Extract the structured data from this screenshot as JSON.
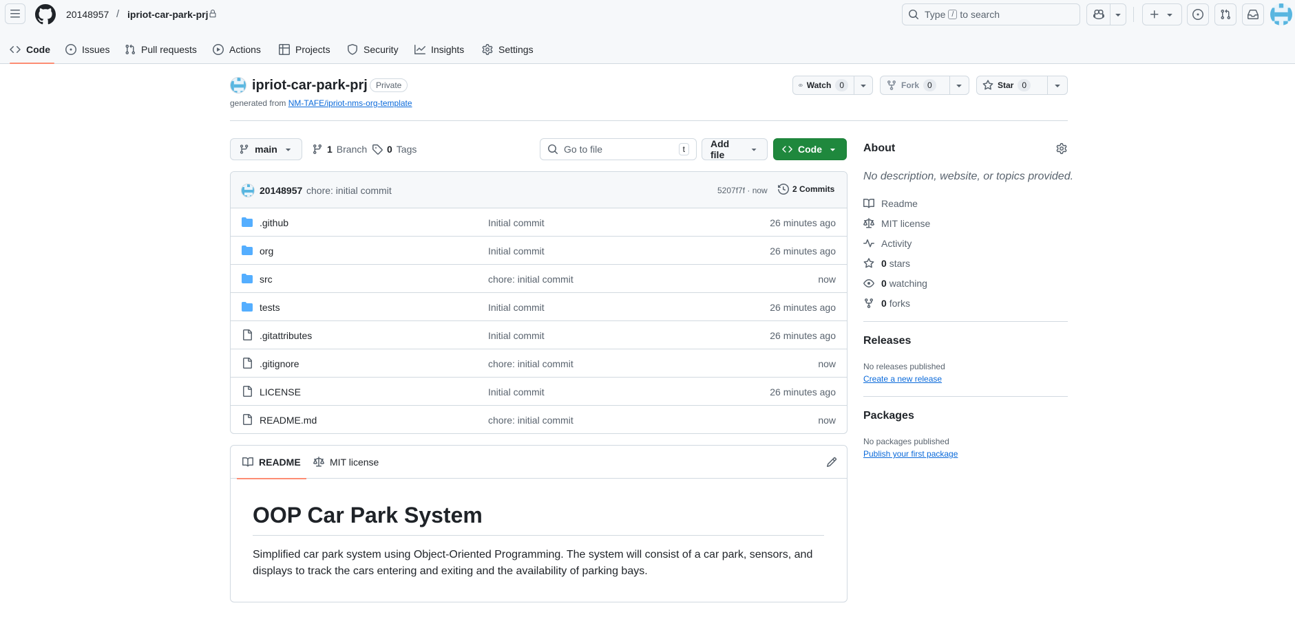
{
  "header": {
    "owner": "20148957",
    "separator": "/",
    "repo": "ipriot-car-park-prj",
    "search": {
      "prefix": "Type",
      "key": "/",
      "suffix": "to search"
    }
  },
  "repo_nav": [
    {
      "label": "Code",
      "icon": "code-icon",
      "active": true
    },
    {
      "label": "Issues",
      "icon": "issue-opened-icon"
    },
    {
      "label": "Pull requests",
      "icon": "git-pull-request-icon"
    },
    {
      "label": "Actions",
      "icon": "play-icon"
    },
    {
      "label": "Projects",
      "icon": "table-icon"
    },
    {
      "label": "Security",
      "icon": "shield-icon"
    },
    {
      "label": "Insights",
      "icon": "graph-icon"
    },
    {
      "label": "Settings",
      "icon": "gear-icon"
    }
  ],
  "repo": {
    "name": "ipriot-car-park-prj",
    "visibility": "Private",
    "generated_prefix": "generated from",
    "template_link": "NM-TAFE/ipriot-nms-org-template"
  },
  "actions": {
    "watch": {
      "label": "Watch",
      "count": "0"
    },
    "fork": {
      "label": "Fork",
      "count": "0"
    },
    "star": {
      "label": "Star",
      "count": "0"
    }
  },
  "toolbar": {
    "branch": "main",
    "branches_count": "1",
    "branches_label": "Branch",
    "tags_count": "0",
    "tags_label": "Tags",
    "goto_placeholder": "Go to file",
    "goto_key": "t",
    "add_file": "Add file",
    "code": "Code"
  },
  "latest_commit": {
    "author": "20148957",
    "message": "chore: initial commit",
    "sha_time": "5207f7f · now",
    "commits": "2 Commits"
  },
  "files": [
    {
      "name": ".github",
      "type": "dir",
      "message": "Initial commit",
      "date": "26 minutes ago"
    },
    {
      "name": "org",
      "type": "dir",
      "message": "Initial commit",
      "date": "26 minutes ago"
    },
    {
      "name": "src",
      "type": "dir",
      "message": "chore: initial commit",
      "date": "now"
    },
    {
      "name": "tests",
      "type": "dir",
      "message": "Initial commit",
      "date": "26 minutes ago"
    },
    {
      "name": ".gitattributes",
      "type": "file",
      "message": "Initial commit",
      "date": "26 minutes ago"
    },
    {
      "name": ".gitignore",
      "type": "file",
      "message": "chore: initial commit",
      "date": "now"
    },
    {
      "name": "LICENSE",
      "type": "file",
      "message": "Initial commit",
      "date": "26 minutes ago"
    },
    {
      "name": "README.md",
      "type": "file",
      "message": "chore: initial commit",
      "date": "now"
    }
  ],
  "readme": {
    "tab_readme": "README",
    "tab_license": "MIT license",
    "heading": "OOP Car Park System",
    "paragraph_line1": "Simplified car park system using Object-Oriented Programming. The system will consist of a car park, sensors, and",
    "paragraph_line2": "displays to track the cars entering and exiting and the availability of parking bays."
  },
  "sidebar": {
    "about_title": "About",
    "about_desc": "No description, website, or topics provided.",
    "readme": "Readme",
    "license": "MIT license",
    "activity": "Activity",
    "stars_count": "0",
    "stars_label": "stars",
    "watching_count": "0",
    "watching_label": "watching",
    "forks_count": "0",
    "forks_label": "forks",
    "releases_title": "Releases",
    "releases_none": "No releases published",
    "releases_link": "Create a new release",
    "packages_title": "Packages",
    "packages_none": "No packages published",
    "packages_link": "Publish your first package"
  },
  "colors": {
    "accent_underline": "#fd8c73",
    "primary_green": "#1f883d",
    "link_blue": "#0969da",
    "folder_blue": "#54aeff"
  }
}
